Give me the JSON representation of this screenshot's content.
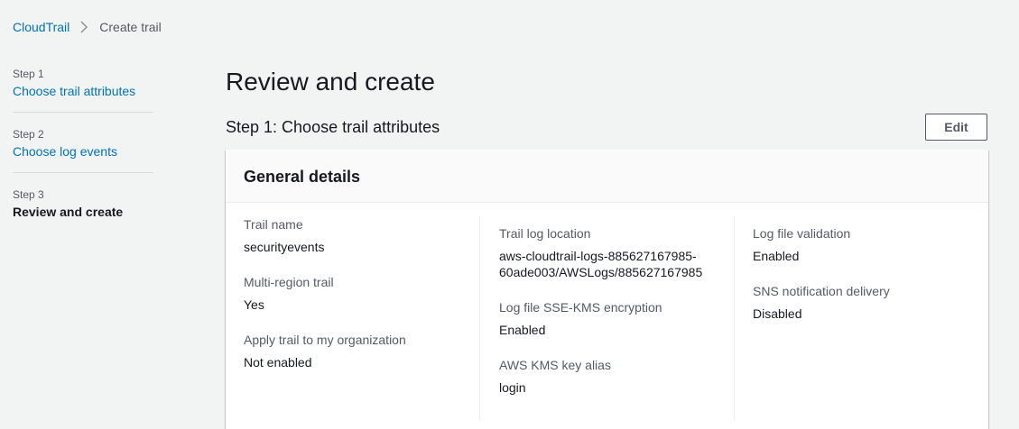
{
  "breadcrumb": {
    "root": "CloudTrail",
    "current": "Create trail"
  },
  "steps": [
    {
      "num": "Step 1",
      "label": "Choose trail attributes"
    },
    {
      "num": "Step 2",
      "label": "Choose log events"
    },
    {
      "num": "Step 3",
      "label": "Review and create"
    }
  ],
  "page": {
    "title": "Review and create",
    "section_title": "Step 1: Choose trail attributes",
    "edit_label": "Edit"
  },
  "panel": {
    "title": "General details",
    "col1": [
      {
        "key": "Trail name",
        "value": "securityevents"
      },
      {
        "key": "Multi-region trail",
        "value": "Yes"
      },
      {
        "key": "Apply trail to my organization",
        "value": "Not enabled"
      }
    ],
    "col2": [
      {
        "key": "Trail log location",
        "value_line1": "aws-cloudtrail-logs-885627167985-",
        "value_line2": "60ade003/AWSLogs/885627167985"
      },
      {
        "key": "Log file SSE-KMS encryption",
        "value": "Enabled"
      },
      {
        "key": "AWS KMS key alias",
        "value": "login"
      }
    ],
    "col3": [
      {
        "key": "Log file validation",
        "value": "Enabled"
      },
      {
        "key": "SNS notification delivery",
        "value": "Disabled"
      }
    ]
  },
  "colors": {
    "link": "#0073bb",
    "text": "#16191f",
    "muted": "#545b64",
    "background": "#f2f3f3"
  },
  "icons": {
    "breadcrumb_separator": "chevron-right-icon"
  }
}
